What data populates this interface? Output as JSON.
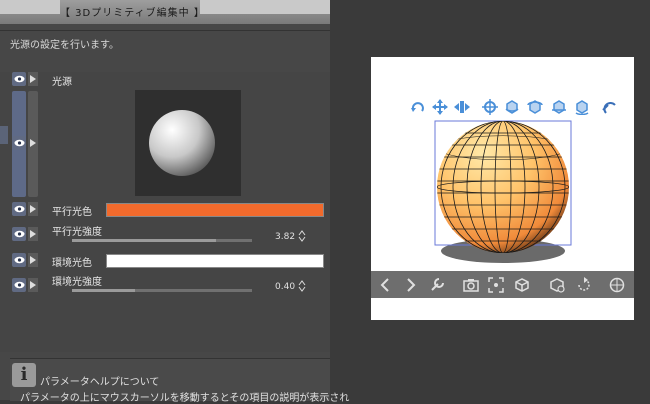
{
  "banner": {
    "title": "【 3Dプリミティブ編集中 】"
  },
  "description": "光源の設定を行います。",
  "light_section": {
    "label": "光源"
  },
  "properties": {
    "parallel_color": {
      "label": "平行光色",
      "color": "#f26a2c"
    },
    "parallel_strength": {
      "label": "平行光強度",
      "value": "3.82",
      "level": 0.8
    },
    "ambient_color": {
      "label": "環境光色",
      "color": "#ffffff"
    },
    "ambient_strength": {
      "label": "環境光強度",
      "value": "0.40",
      "level": 0.35
    }
  },
  "help": {
    "title": "パラメータヘルプについて",
    "text": "パラメータの上にマウスカーソルを移動するとその項目の説明が表示され"
  },
  "gizmo_icons": [
    "camera-rotate-icon",
    "camera-pan-icon",
    "camera-zoom-icon",
    "move-icon",
    "object-rotate-icon",
    "object-rotate-x-icon",
    "object-rotate-y-icon",
    "snap-icon"
  ],
  "bottom_toolbar_icons": [
    "prev-icon",
    "next-icon",
    "wrench-icon",
    "camera-icon",
    "fit-icon",
    "object-icon",
    "object-settings-icon",
    "reset-icon",
    "floor-grid-icon"
  ],
  "colors": {
    "accent": "#4a8fd8",
    "sphere_light": "#ffd27a",
    "sphere_dark": "#e86a1e"
  }
}
